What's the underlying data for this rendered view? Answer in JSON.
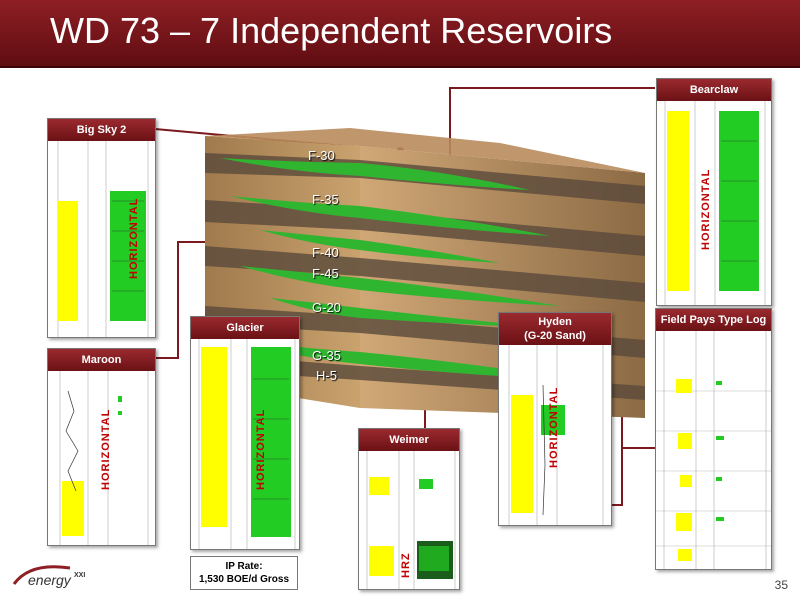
{
  "slide": {
    "title": "WD 73 – 7 Independent Reservoirs",
    "page_number": "35",
    "ip_rate_line1": "IP Rate:",
    "ip_rate_line2": "1,530 BOE/d Gross",
    "logo_text": "energy",
    "logo_suffix": "XXI"
  },
  "horizons": [
    "F-30",
    "F-35",
    "F-40",
    "F-45",
    "G-20",
    "G-35",
    "H-5"
  ],
  "panels": {
    "big_sky": {
      "label": "Big Sky 2",
      "tag": "HORIZONTAL"
    },
    "maroon": {
      "label": "Maroon",
      "tag": "HORIZONTAL"
    },
    "glacier": {
      "label": "Glacier",
      "tag": "HORIZONTAL"
    },
    "weimer": {
      "label": "Weimer",
      "tag": "HRZ"
    },
    "hyden": {
      "label_line1": "Hyden",
      "label_line2": "(G-20 Sand)",
      "tag": "HORIZONTAL"
    },
    "bearclaw": {
      "label": "Bearclaw",
      "tag": "HORIZONTAL"
    },
    "field_pays": {
      "label": "Field Pays Type Log"
    }
  },
  "colors": {
    "brand": "#7a1a1e",
    "log_green": "#22cc22",
    "log_yellow": "#ffff00",
    "tag_red": "#c00000"
  }
}
